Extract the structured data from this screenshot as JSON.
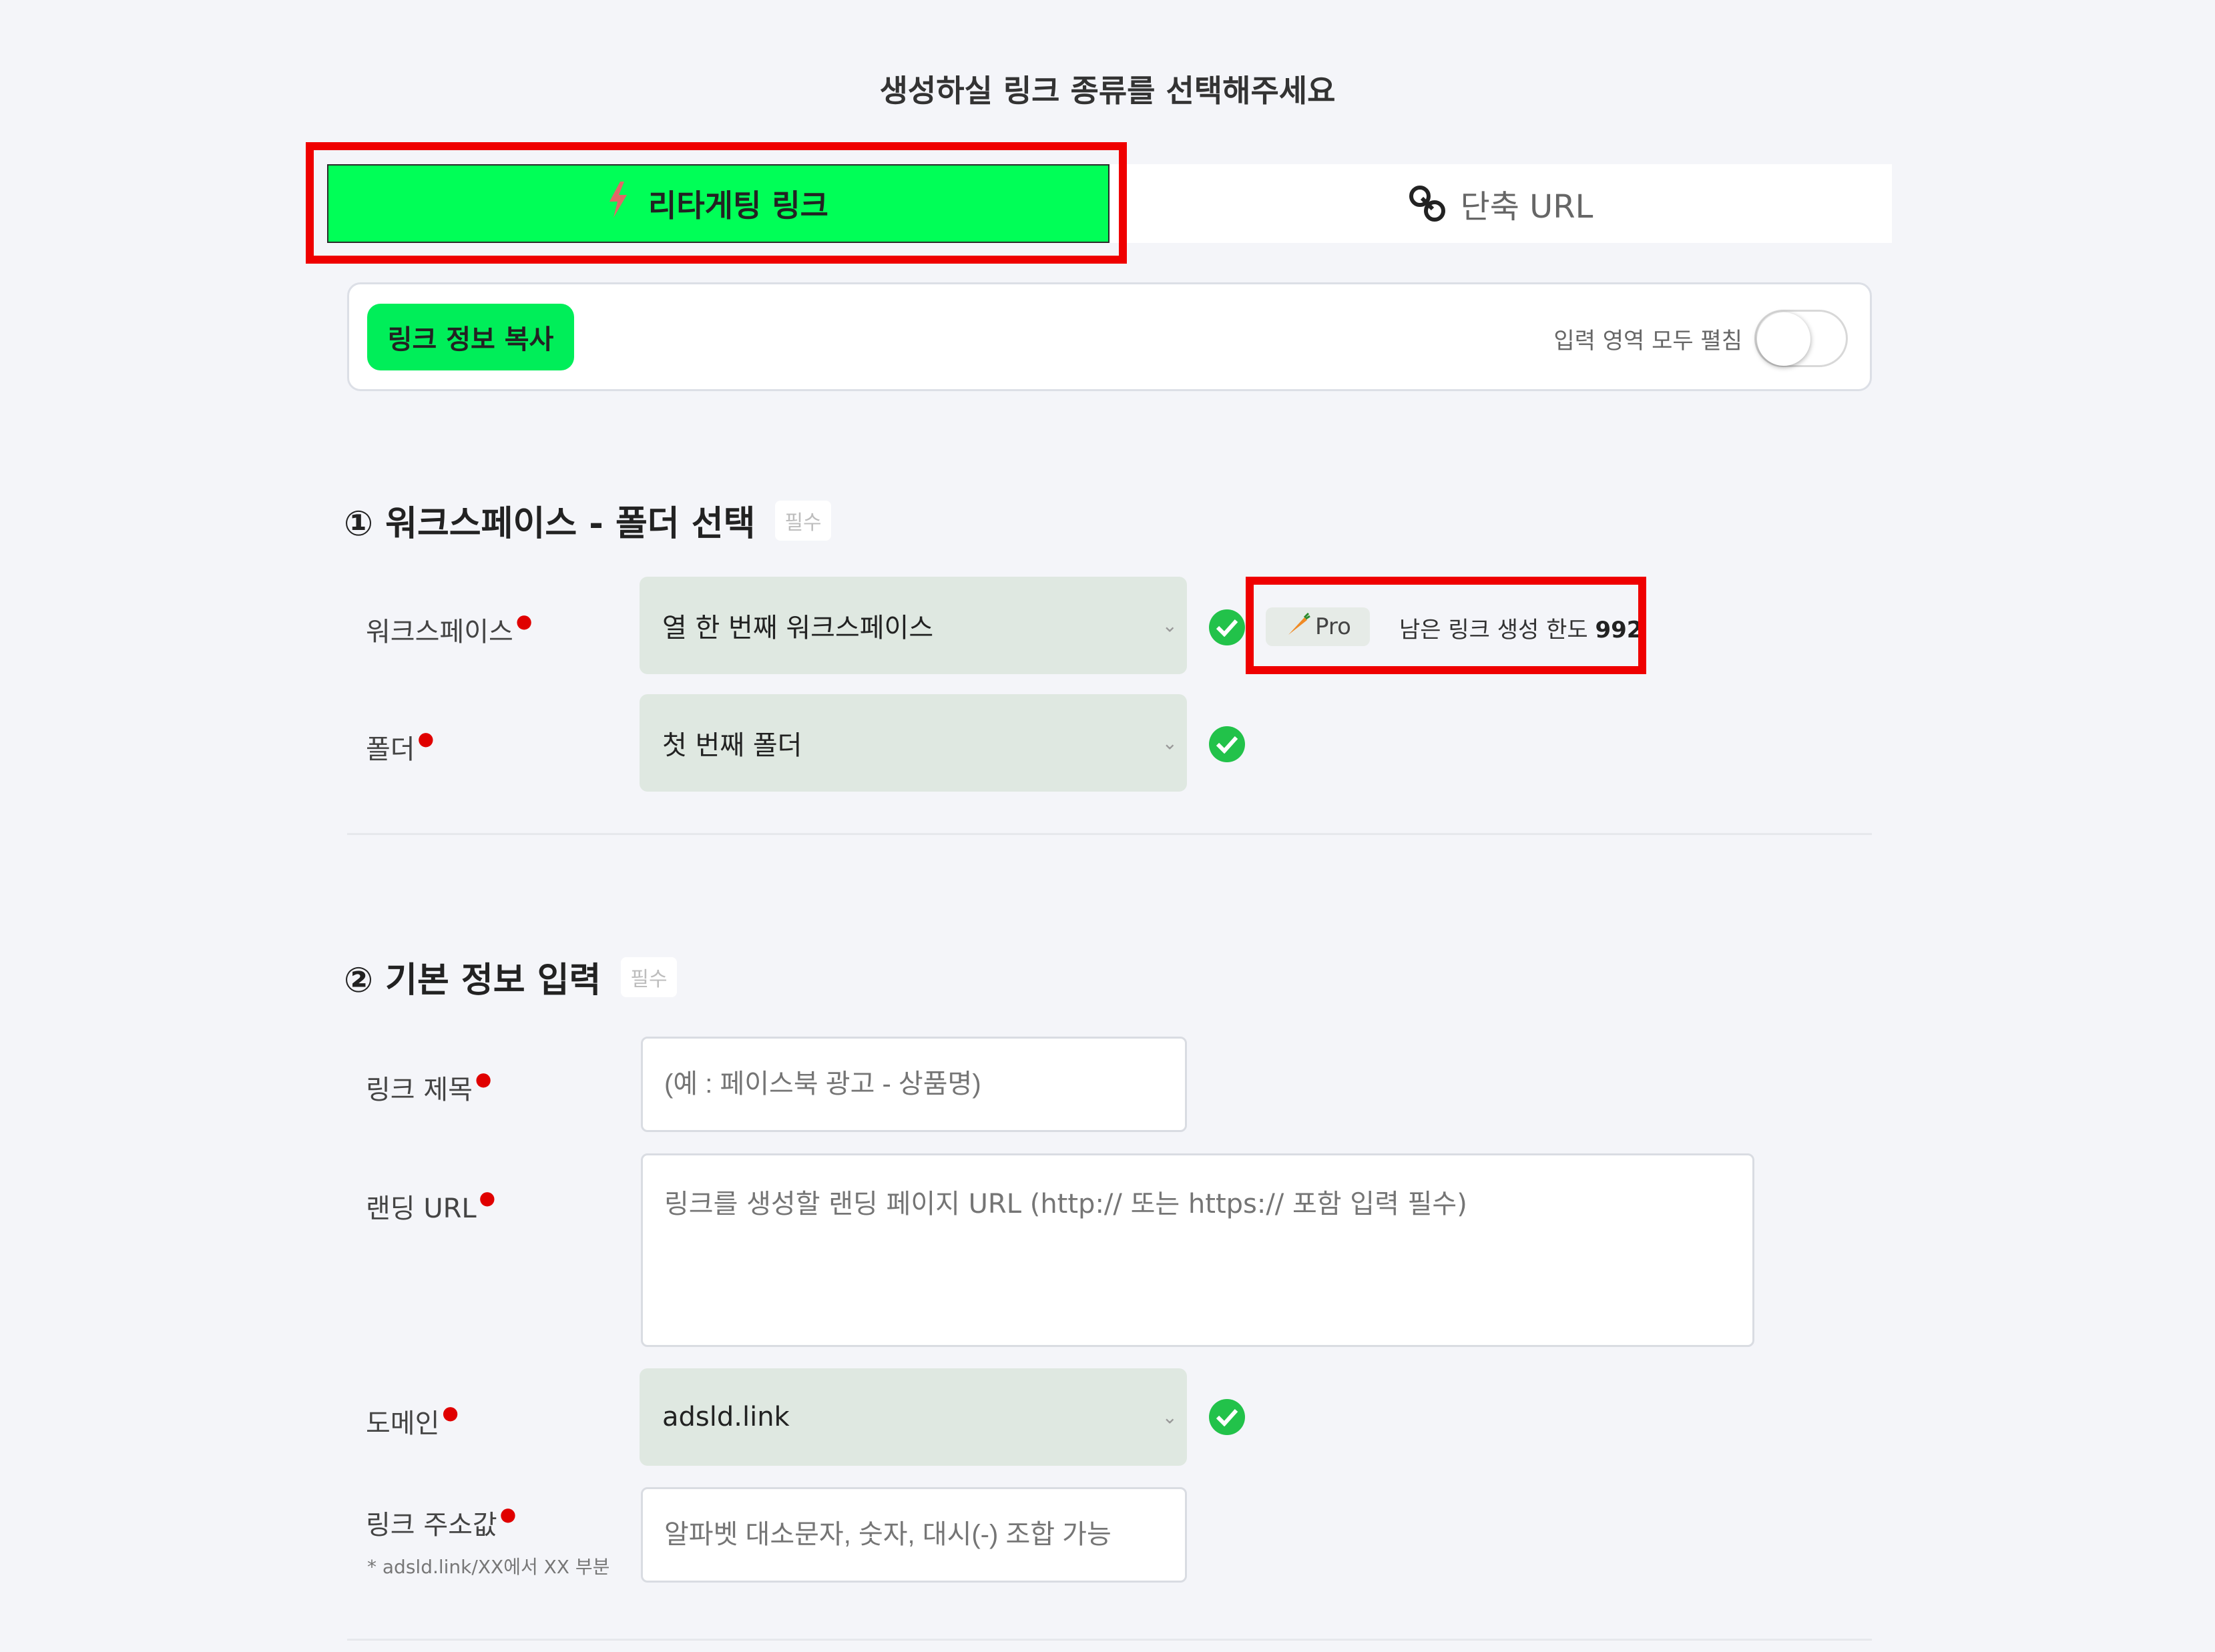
{
  "page_title": "생성하실 링크 종류를 선택해주세요",
  "tabs": {
    "retargeting": "리타게팅 링크",
    "short_url": "단축 URL"
  },
  "toolbar": {
    "copy_button": "링크 정보 복사",
    "expand_all_label": "입력 영역 모두 펼침",
    "expand_all_on": false
  },
  "section1": {
    "title": "① 워크스페이스 - 폴더 선택",
    "required_badge": "필수",
    "workspace_label": "워크스페이스",
    "workspace_value": "열 한 번째 워크스페이스",
    "plan_badge": "Pro",
    "remaining_label": "남은 링크 생성 한도",
    "remaining_value": "992",
    "folder_label": "폴더",
    "folder_value": "첫 번째 폴더"
  },
  "section2": {
    "title": "② 기본 정보 입력",
    "required_badge": "필수",
    "link_title_label": "링크 제목",
    "link_title_placeholder": "(예 : 페이스북 광고 - 상품명)",
    "landing_url_label": "랜딩 URL",
    "landing_url_placeholder": "링크를 생성할 랜딩 페이지 URL (http:// 또는 https:// 포함 입력 필수)",
    "domain_label": "도메인",
    "domain_value": "adsld.link",
    "slug_label": "링크 주소값",
    "slug_hint": "* adsld.link/XX에서 XX 부분",
    "slug_placeholder": "알파벳 대소문자, 숫자, 대시(-) 조합 가능"
  },
  "colors": {
    "accent_green": "#00ff57",
    "highlight_red": "#ef0000",
    "check_green": "#22c24a"
  }
}
